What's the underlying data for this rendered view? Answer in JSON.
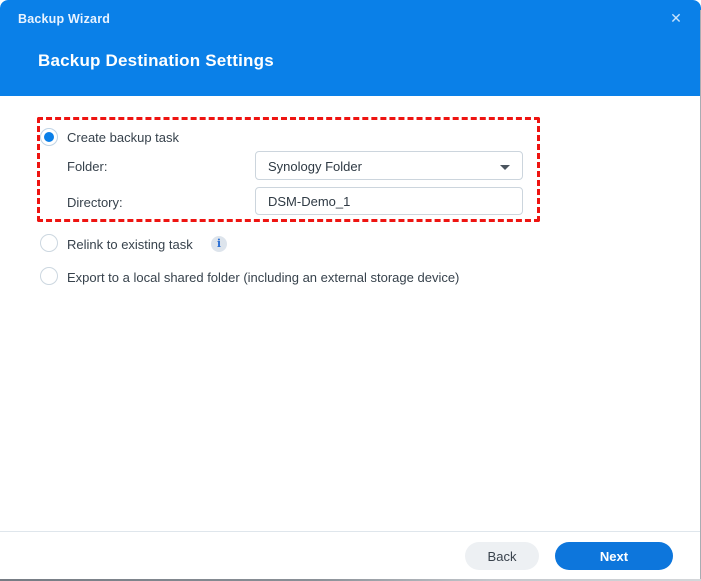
{
  "window": {
    "title": "Backup Wizard",
    "close_glyph": "✕"
  },
  "header": {
    "heading": "Backup Destination Settings"
  },
  "options": {
    "create": {
      "label": "Create backup task",
      "selected": true,
      "fields": [
        {
          "label": "Folder:",
          "type": "select",
          "value": "Synology Folder"
        },
        {
          "label": "Directory:",
          "type": "input",
          "value": "DSM-Demo_1"
        }
      ]
    },
    "relink": {
      "label": "Relink to existing task",
      "selected": false,
      "info_glyph": "i"
    },
    "export": {
      "label": "Export to a local shared folder (including an external storage device)",
      "selected": false
    }
  },
  "footer": {
    "back_label": "Back",
    "next_label": "Next"
  },
  "colors": {
    "header_blue": "#0a80e8",
    "next_button_blue": "#0d76dc",
    "highlight_red": "#ee1411"
  }
}
